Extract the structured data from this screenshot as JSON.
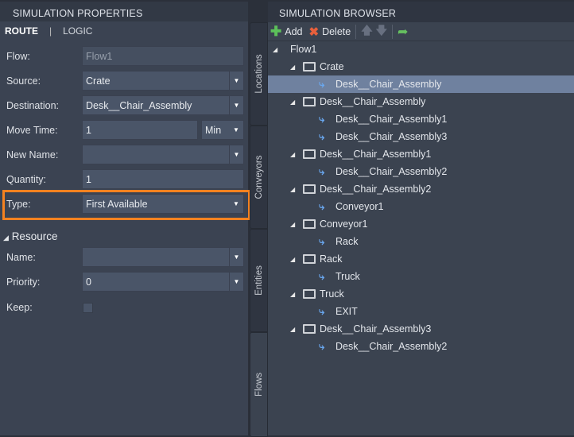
{
  "left_panel": {
    "title": "SIMULATION PROPERTIES",
    "tabs": [
      "ROUTE",
      "LOGIC"
    ],
    "fields": {
      "flow": {
        "label": "Flow:",
        "value": "Flow1"
      },
      "source": {
        "label": "Source:",
        "value": "Crate"
      },
      "destination": {
        "label": "Destination:",
        "value": "Desk__Chair_Assembly"
      },
      "move_time": {
        "label": "Move Time:",
        "value": "1",
        "unit": "Min"
      },
      "new_name": {
        "label": "New Name:",
        "value": ""
      },
      "quantity": {
        "label": "Quantity:",
        "value": "1"
      },
      "type": {
        "label": "Type:",
        "value": "First Available"
      }
    },
    "resource": {
      "title": "Resource",
      "name": {
        "label": "Name:",
        "value": ""
      },
      "priority": {
        "label": "Priority:",
        "value": "0"
      },
      "keep": {
        "label": "Keep:",
        "checked": false
      }
    },
    "highlight_color": "#f58220"
  },
  "side_tabs": [
    "Locations",
    "Conveyors",
    "Entities",
    "Flows"
  ],
  "active_side_tab": "Flows",
  "right_panel": {
    "title": "SIMULATION BROWSER",
    "toolbar": {
      "add": "Add",
      "delete": "Delete"
    },
    "tree": [
      {
        "level": 0,
        "type": "root",
        "label": "Flow1"
      },
      {
        "level": 1,
        "type": "location",
        "label": "Crate"
      },
      {
        "level": 2,
        "type": "flow",
        "label": "Desk__Chair_Assembly",
        "selected": true
      },
      {
        "level": 1,
        "type": "location",
        "label": "Desk__Chair_Assembly"
      },
      {
        "level": 2,
        "type": "flow",
        "label": "Desk__Chair_Assembly1"
      },
      {
        "level": 2,
        "type": "flow",
        "label": "Desk__Chair_Assembly3"
      },
      {
        "level": 1,
        "type": "location",
        "label": "Desk__Chair_Assembly1"
      },
      {
        "level": 2,
        "type": "flow",
        "label": "Desk__Chair_Assembly2"
      },
      {
        "level": 1,
        "type": "location",
        "label": "Desk__Chair_Assembly2"
      },
      {
        "level": 2,
        "type": "flow",
        "label": "Conveyor1"
      },
      {
        "level": 1,
        "type": "location",
        "label": "Conveyor1"
      },
      {
        "level": 2,
        "type": "flow",
        "label": "Rack"
      },
      {
        "level": 1,
        "type": "location",
        "label": "Rack"
      },
      {
        "level": 2,
        "type": "flow",
        "label": "Truck"
      },
      {
        "level": 1,
        "type": "location",
        "label": "Truck"
      },
      {
        "level": 2,
        "type": "flow",
        "label": "EXIT"
      },
      {
        "level": 1,
        "type": "location",
        "label": "Desk__Chair_Assembly3"
      },
      {
        "level": 2,
        "type": "flow",
        "label": "Desk__Chair_Assembly2"
      }
    ]
  }
}
